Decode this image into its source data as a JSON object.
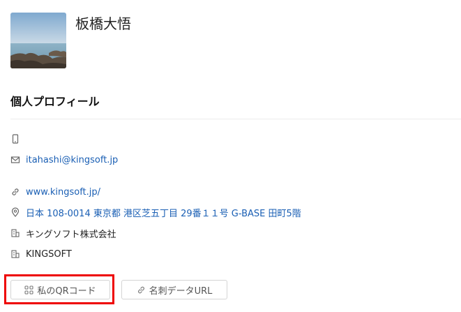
{
  "profile": {
    "name": "板橋大悟",
    "avatar_alt": "seaside-rocks-photo"
  },
  "section": {
    "title": "個人プロフィール"
  },
  "details": {
    "phone": "",
    "email": "itahashi@kingsoft.jp",
    "website": "www.kingsoft.jp/",
    "address": "日本 108-0014 東京都 港区芝五丁目 29番１１号 G-BASE 田町5階",
    "company": "キングソフト株式会社",
    "company_en": "KINGSOFT"
  },
  "actions": {
    "qr_label": "私のQRコード",
    "card_url_label": "名刺データURL"
  },
  "colors": {
    "link": "#1a5fb4",
    "highlight": "#e00000"
  }
}
